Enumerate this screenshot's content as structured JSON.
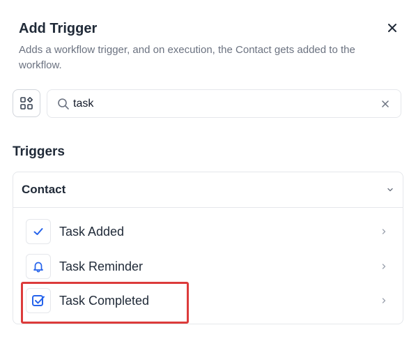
{
  "dialog": {
    "title": "Add Trigger",
    "description": "Adds a workflow trigger, and on execution, the Contact gets added to the workflow."
  },
  "search": {
    "value": "task",
    "placeholder": "Search"
  },
  "section": {
    "heading": "Triggers"
  },
  "group": {
    "label": "Contact",
    "items": [
      {
        "label": "Task Added",
        "icon": "check-icon"
      },
      {
        "label": "Task Reminder",
        "icon": "bell-icon"
      },
      {
        "label": "Task Completed",
        "icon": "checkbox-checked-icon"
      }
    ]
  },
  "colors": {
    "accent": "#2563eb",
    "highlight": "#dc3b3b"
  }
}
